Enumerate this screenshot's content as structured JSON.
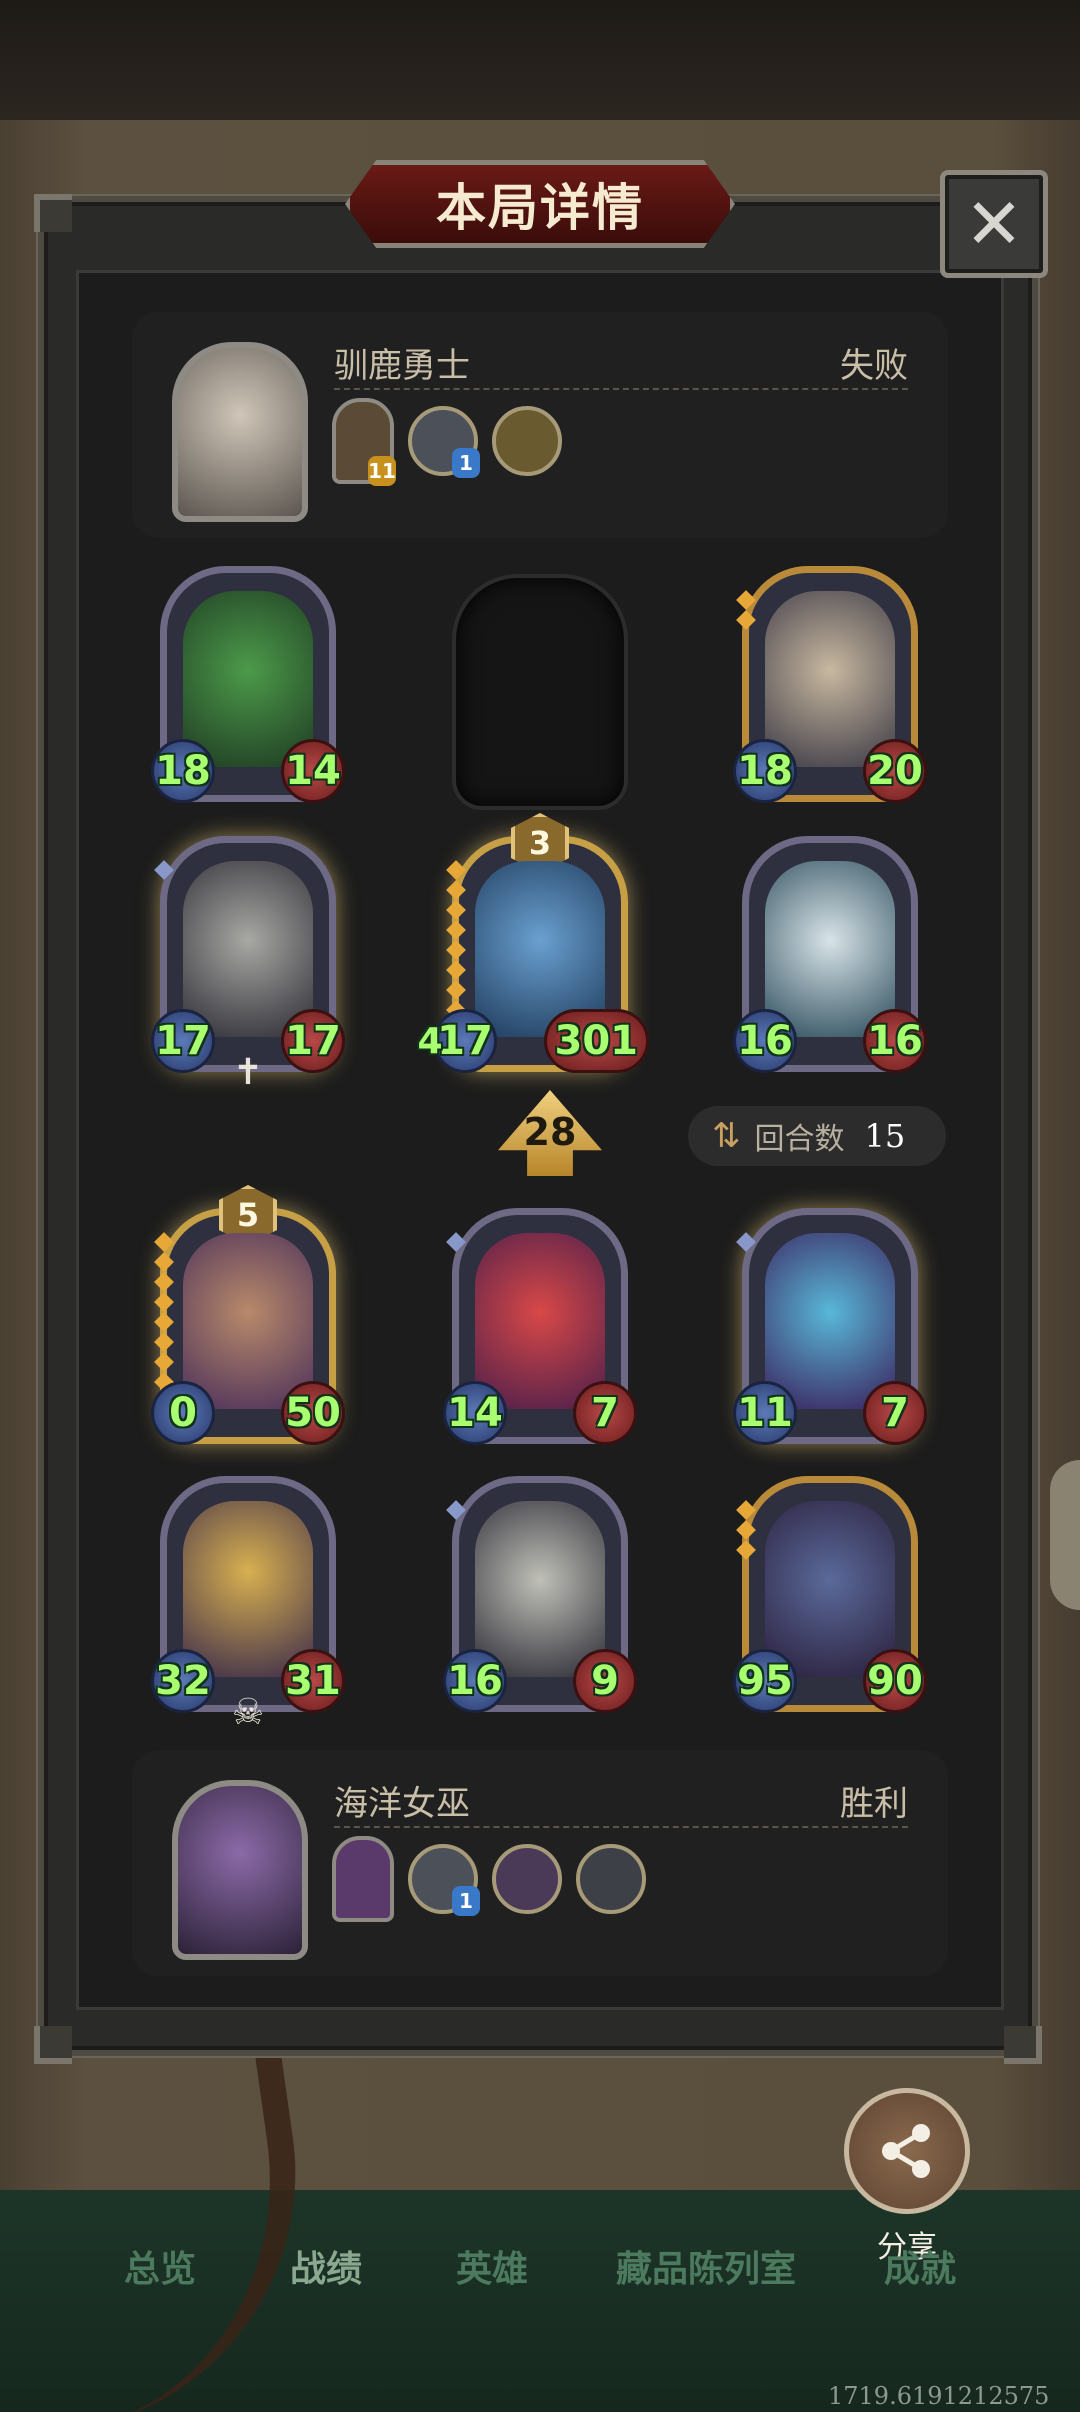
{
  "title": "本局详情",
  "close_icon": "close-icon",
  "top_player": {
    "name": "驯鹿勇士",
    "result": "失败",
    "hero_icon": "reindeer-warrior-portrait",
    "items": [
      {
        "type": "rect",
        "badge": "11"
      },
      {
        "type": "circle",
        "badge": "1"
      },
      {
        "type": "circle",
        "badge": ""
      }
    ]
  },
  "bottom_player": {
    "name": "海洋女巫",
    "result": "胜利",
    "hero_icon": "sea-witch-portrait",
    "items": [
      {
        "type": "rect",
        "badge": ""
      },
      {
        "type": "circle",
        "badge": "1"
      },
      {
        "type": "circle",
        "badge": ""
      },
      {
        "type": "circle",
        "badge": ""
      }
    ]
  },
  "enemy_board": [
    {
      "name": "green-dragon",
      "atk": "18",
      "hp": "14"
    },
    {
      "name": "empty",
      "atk": "",
      "hp": ""
    },
    {
      "name": "horned-beast",
      "atk": "18",
      "hp": "20"
    },
    {
      "name": "grey-dragon",
      "atk": "17",
      "hp": "17"
    },
    {
      "name": "blue-dragon",
      "atk": "17",
      "hp": "301",
      "level": "3",
      "extra": "4"
    },
    {
      "name": "white-serpent-dragon",
      "atk": "16",
      "hp": "16"
    }
  ],
  "turn": {
    "attack_arrow_value": "28",
    "round_label": "回合数",
    "round_value": "15"
  },
  "player_board": [
    {
      "name": "archer",
      "atk": "0",
      "hp": "50",
      "level": "5"
    },
    {
      "name": "clown",
      "atk": "14",
      "hp": "7"
    },
    {
      "name": "fairy",
      "atk": "11",
      "hp": "7"
    },
    {
      "name": "mech-sphere",
      "atk": "32",
      "hp": "31"
    },
    {
      "name": "bone-dragon",
      "atk": "16",
      "hp": "9"
    },
    {
      "name": "shadow-beast",
      "atk": "95",
      "hp": "90"
    }
  ],
  "share": {
    "label": "分享",
    "icon": "share-icon"
  },
  "tabs": [
    "总览",
    "战绩",
    "英雄",
    "藏品陈列室",
    "成就"
  ],
  "active_tab": "战绩",
  "version": "1719.6191212575",
  "colors": {
    "stat_text": "#a8ff70",
    "title_plate": "#6a1a16",
    "card_gold": "#c7a046"
  }
}
